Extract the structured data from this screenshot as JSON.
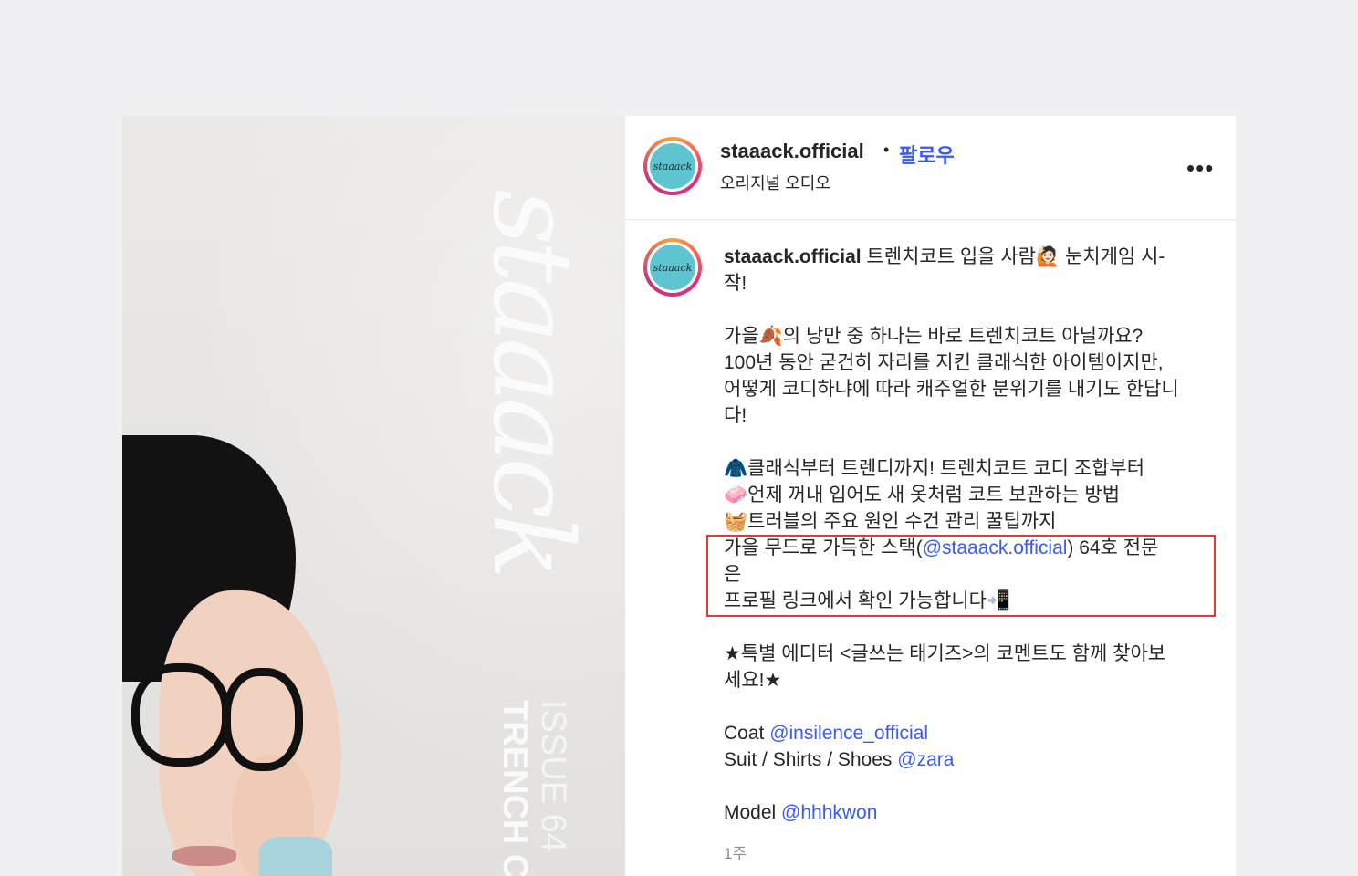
{
  "post": {
    "username": "staaack.official",
    "separator": "•",
    "follow_label": "팔로우",
    "audio_label": "오리지널 오디오",
    "more_label": "•••",
    "avatar_text": "staaack",
    "time_ago": "1주"
  },
  "media": {
    "brand_text": "staaack",
    "issue_text": "ISSUE 64",
    "trench_text": "TRENCH C"
  },
  "caption": {
    "username": "staaack.official",
    "line1_rest": " 트렌치코트 입을 사람🙋🏻 눈치게임 시-",
    "line2": "작!",
    "line4": "가을🍂의 낭만 중 하나는 바로 트렌치코트 아닐까요?",
    "line5": "100년 동안 굳건히 자리를 지킨 클래식한 아이템이지만,",
    "line6": "어떻게 코디하냐에 따라 캐주얼한 분위기를 내기도 한답니",
    "line7": "다!",
    "line9": "🧥클래식부터 트렌디까지! 트렌치코트 코디 조합부터",
    "line10": "🧼언제 꺼내 입어도 새 옷처럼 코트 보관하는 방법",
    "line11": "🧺트러블의 주요 원인 수건 관리 꿀팁까지",
    "line12_a": " 가을 무드로 가득한 스택(",
    "line12_mention": "@staaack.official",
    "line12_b": ") 64호 전문",
    "line13": "은",
    "line14": "프로필 링크에서 확인 가능합니다📲",
    "line16": "★특별 에디터 <글쓰는 태기즈>의 코멘트도 함께 찾아보",
    "line17": "세요!★",
    "coat_label": "Coat ",
    "coat_mention": "@insilence_official",
    "suit_label": "Suit / Shirts / Shoes ",
    "suit_mention": "@zara",
    "model_label": "Model ",
    "model_mention": "@hhhkwon"
  },
  "colors": {
    "mention": "#3b5bf0",
    "highlight_border": "#e03a3a",
    "avatar_fill": "#5ec4cf"
  }
}
